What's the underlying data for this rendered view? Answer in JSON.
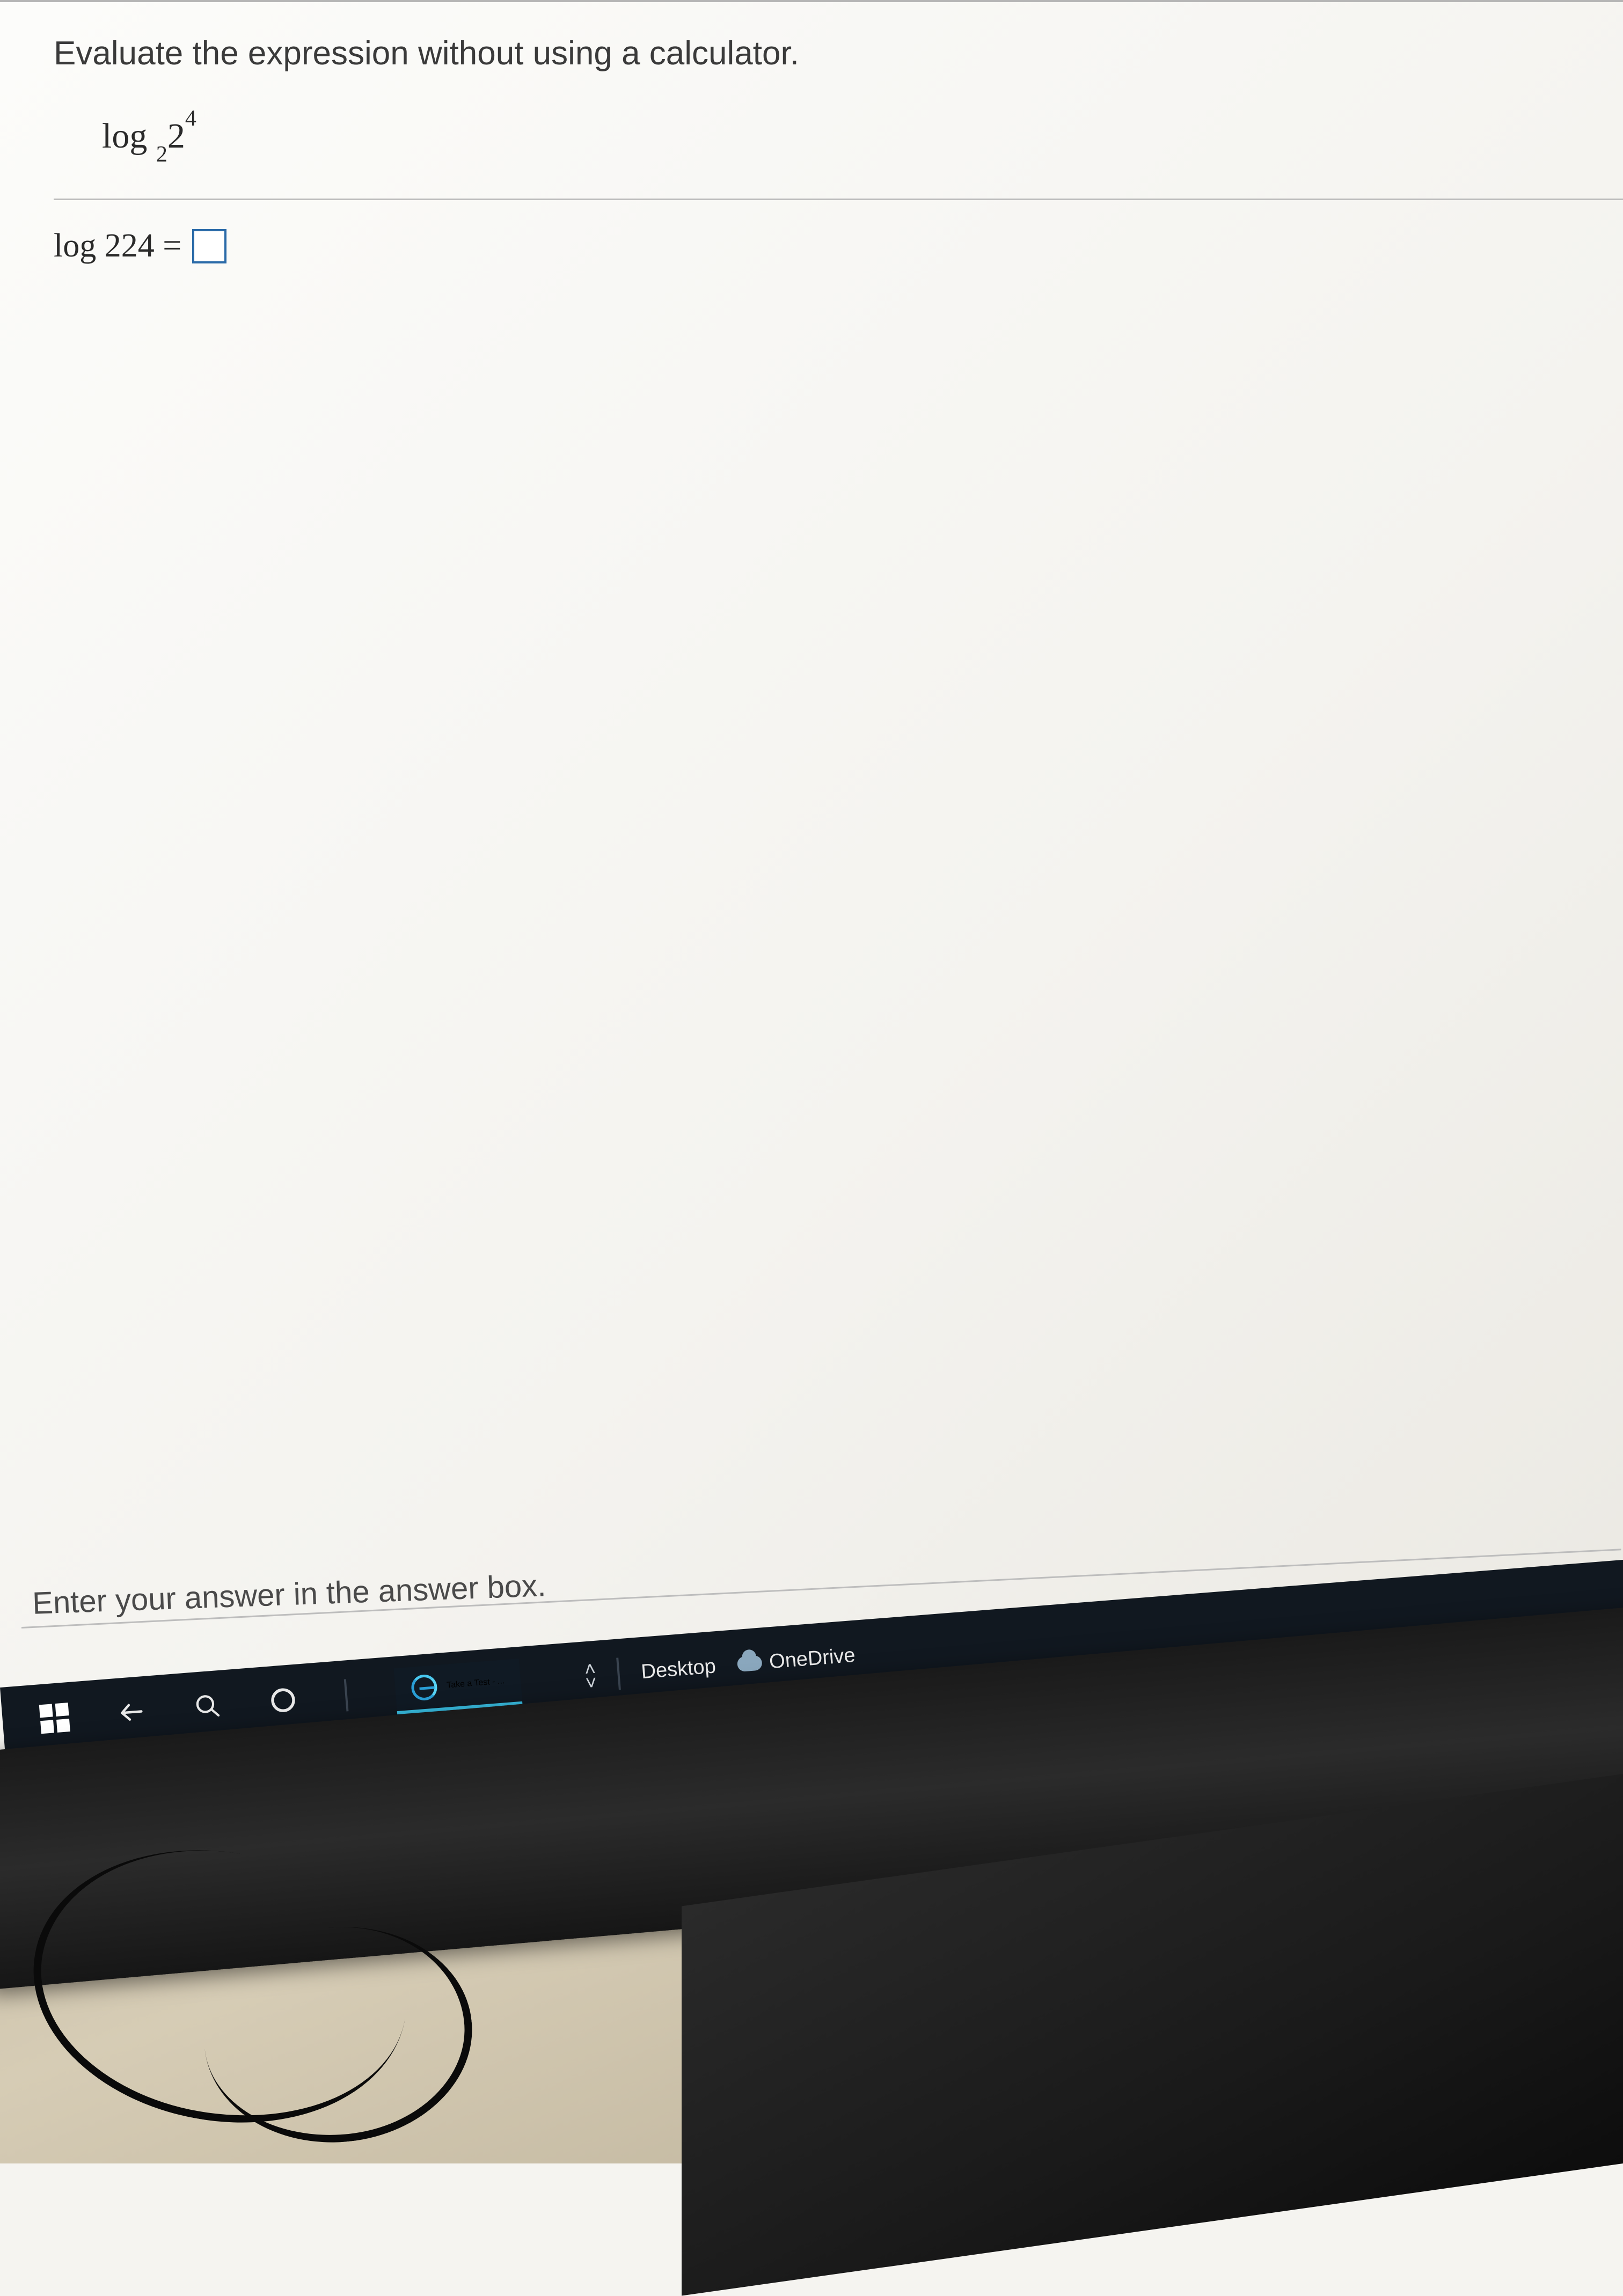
{
  "question": {
    "prompt": "Evaluate the expression without using a calculator.",
    "expression": {
      "function": "log",
      "subscript": "2",
      "base": "2",
      "exponent": "4"
    },
    "answer_line": {
      "function": "log",
      "subscript": "2",
      "base": "2",
      "exponent": "4",
      "equals": "="
    },
    "hint": "Enter your answer in the answer box."
  },
  "taskbar": {
    "active_app": "Take a Test - ...",
    "tray": {
      "desktop": "Desktop",
      "onedrive": "OneDrive"
    }
  }
}
